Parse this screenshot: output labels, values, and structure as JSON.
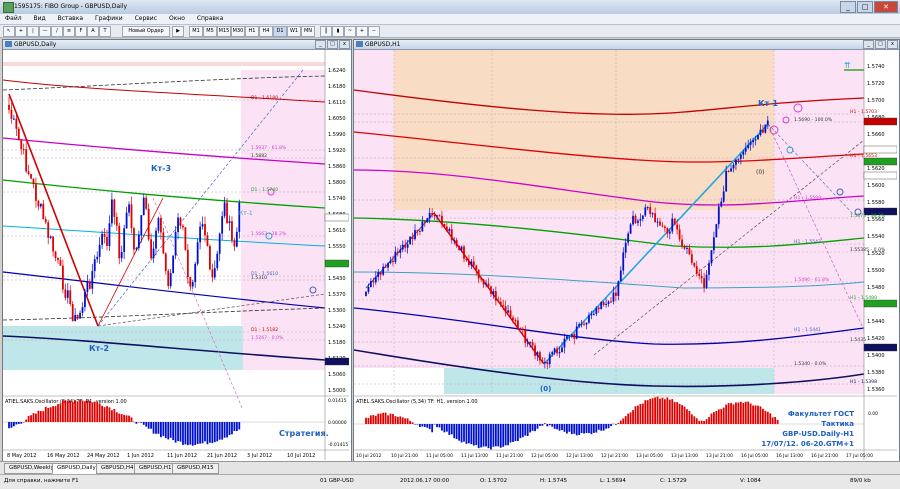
{
  "window_title": "1595175: FIBO Group - GBPUSD,Daily",
  "menu": [
    "Файл",
    "Вид",
    "Вставка",
    "Графики",
    "Сервис",
    "Окно",
    "Справка"
  ],
  "toolbar": {
    "new_order": "Новый Ордер",
    "timeframes": [
      "M1",
      "M5",
      "M15",
      "M30",
      "H1",
      "H4",
      "D1",
      "W1",
      "MN"
    ]
  },
  "left": {
    "title": "GBPUSD,Daily",
    "labels": {
      "kt3": "Кт-3",
      "kt2": "Кт-2",
      "kt1": "Кт-1",
      "strategy": "Стратегия."
    },
    "oscillator_title": "ATIEL.SAKS.Oscillator (5,34) TF: D1, version 1.00",
    "prices": [
      "1.6240",
      "1.6180",
      "1.6110",
      "1.6050",
      "1.5990",
      "1.5920",
      "1.5860",
      "1.5800",
      "1.5740",
      "1.5680",
      "1.5610",
      "1.5550",
      "1.5490",
      "1.5430",
      "1.5370",
      "1.5300",
      "1.5240",
      "1.5180",
      "1.5120",
      "1.5060",
      "1.5000"
    ],
    "dates": [
      "8 May 2012",
      "16 May 2012",
      "24 May 2012",
      "1 Jun 2012",
      "11 Jun 2012",
      "21 Jun 2012",
      "3 Jul 2012",
      "10 Jul 2012"
    ],
    "level_labels": [
      "D1 - 1.6180",
      "1.5937 - 61.8%",
      "1.5882",
      "D1 - 1.5740",
      "1.5663 - 38.2%",
      "D1 - 1.5610",
      "1.5310",
      "D1 - 1.5182",
      "1.5267 - 0.0%"
    ]
  },
  "right": {
    "title": "GBPUSD,H1",
    "labels": {
      "kt1": "Кт-1",
      "zero": "(0)",
      "zero_mid": "(0)"
    },
    "oscillator_title": "ATIEL.SAKS.Oscillator (5,34) TF: H1, version 1.00",
    "prices": [
      "1.5740",
      "1.5720",
      "1.5700",
      "1.5680",
      "1.5660",
      "1.5640",
      "1.5620",
      "1.5600",
      "1.5580",
      "1.5560",
      "1.5540",
      "1.5520",
      "1.5500",
      "1.5480",
      "1.5460",
      "1.5440",
      "1.5420",
      "1.5400",
      "1.5380",
      "1.5360"
    ],
    "dates": [
      "10 Jul 2012",
      "10 Jul 21:00",
      "11 Jul 05:00",
      "11 Jul 13:00",
      "11 Jul 21:00",
      "12 Jul 05:00",
      "12 Jul 13:00",
      "12 Jul 21:00",
      "13 Jul 05:00",
      "13 Jul 13:00",
      "13 Jul 21:00",
      "16 Jul 05:00",
      "16 Jul 13:00",
      "16 Jul 21:00",
      "17 Jul 05:00"
    ],
    "level_labels": [
      "H1 - 1.5703",
      "1.5690 - 100.0%",
      "H1 - 1.5653",
      "H1 - 1.5599",
      "1.5575 - 38.2%",
      "H1 - 1.5547",
      "1.55385 - 0.0%",
      "1.5490 - 61.8%",
      "H1 - 1.5480",
      "H1 - 1.5441",
      "1.5435",
      "1.5340 - 0.0%",
      "H1 - 1.5398"
    ],
    "info": [
      "Факультет ГОСТ",
      "Тактика",
      "GBP-USD.Daily-H1",
      "17/07/12. 06-20.GTM+1"
    ]
  },
  "tabs": [
    "GBPUSD,Weekly",
    "GBPUSD,Daily",
    "GBPUSD,H4",
    "GBPUSD,H1",
    "GBPUSD,M15"
  ],
  "active_tab": 1,
  "status": {
    "help": "Для справки, нажмите F1",
    "profile": "01 GBP-USD",
    "time": "2012.06.17 00:00",
    "o": "O: 1.5702",
    "h": "H: 1.5745",
    "l": "L: 1.5694",
    "c": "C: 1.5729",
    "vol": "V: 1084",
    "conn": "89/0 kb"
  }
}
